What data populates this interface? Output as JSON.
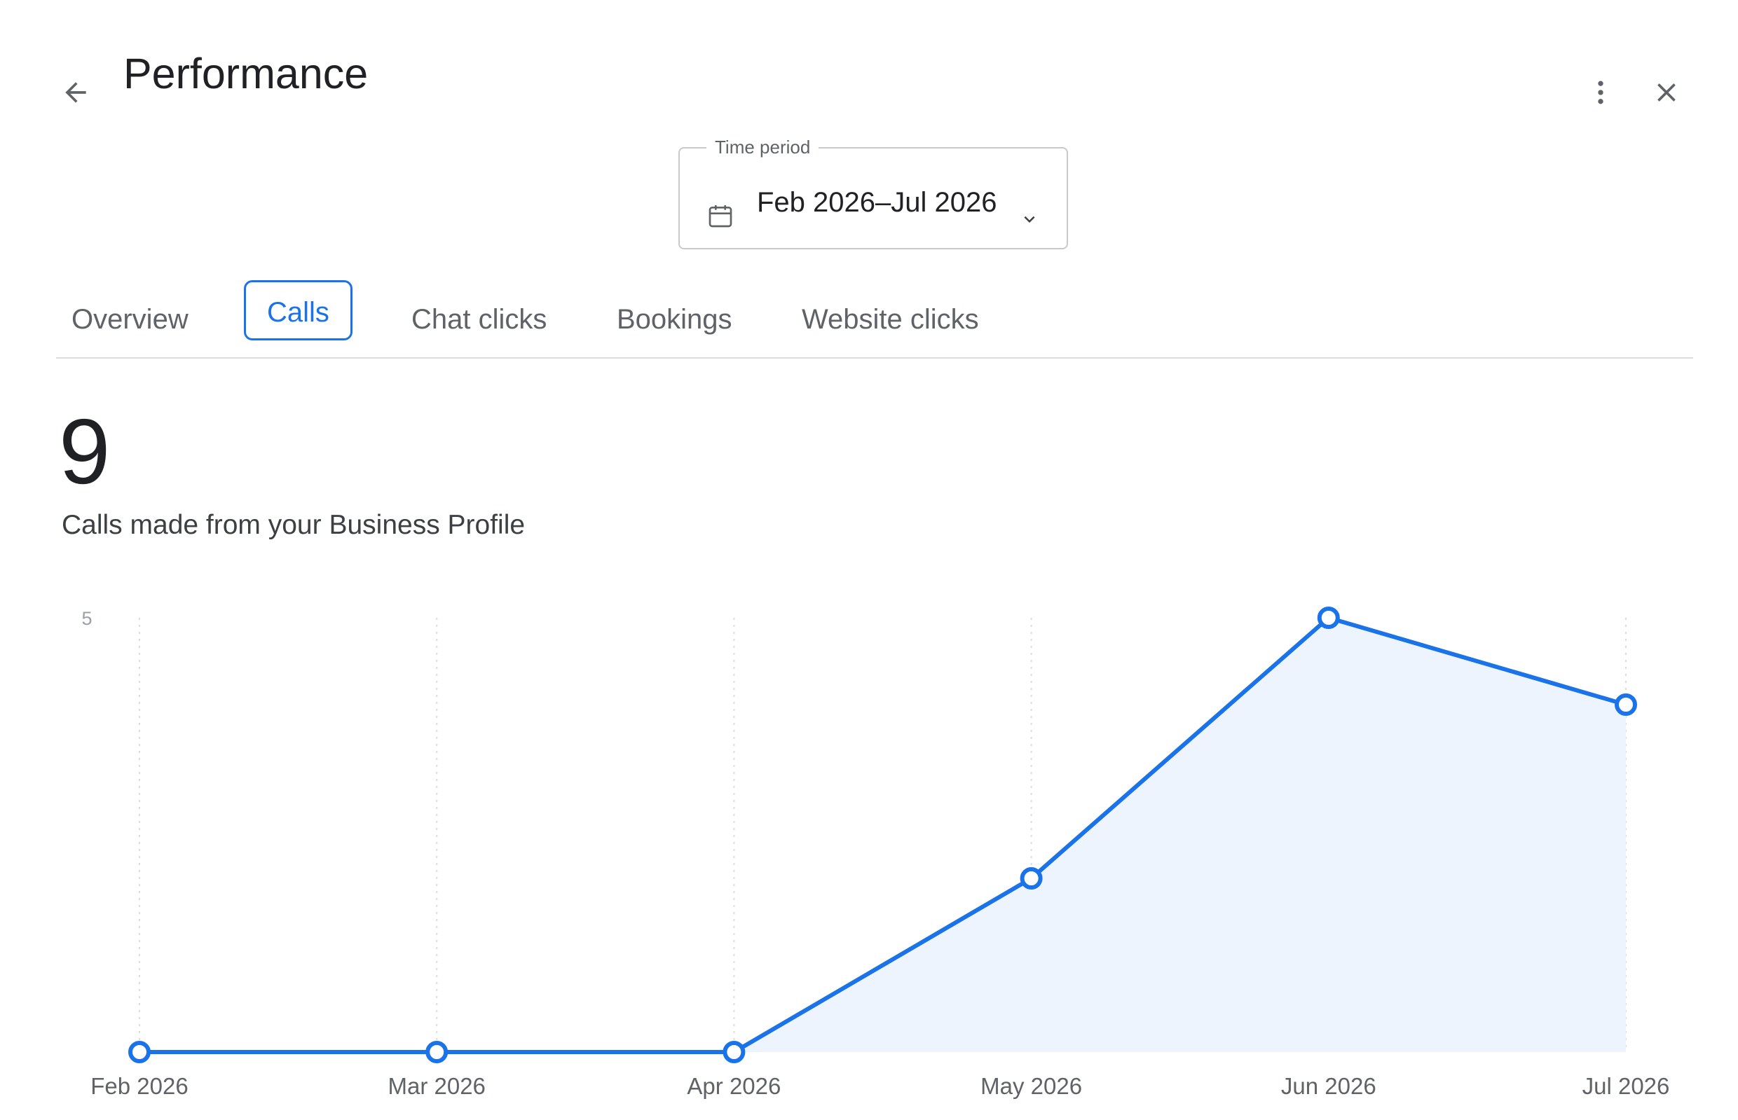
{
  "header": {
    "title": "Performance",
    "back_icon": "arrow-back-icon",
    "more_icon": "more-vert-icon",
    "close_icon": "close-icon"
  },
  "time_period": {
    "label": "Time period",
    "value": "Feb 2026–Jul 2026",
    "icon": "calendar-icon",
    "dropdown_icon": "chevron-down-icon"
  },
  "tabs": [
    {
      "label": "Overview",
      "active": false
    },
    {
      "label": "Calls",
      "active": true
    },
    {
      "label": "Chat clicks",
      "active": false
    },
    {
      "label": "Bookings",
      "active": false
    },
    {
      "label": "Website clicks",
      "active": false
    }
  ],
  "summary": {
    "total": "9",
    "description": "Calls made from your Business Profile"
  },
  "colors": {
    "accent": "#1a73e8",
    "area_fill": "#eef4fd",
    "grid": "#dadce0"
  },
  "chart_data": {
    "type": "area",
    "categories": [
      "Feb 2026",
      "Mar 2026",
      "Apr 2026",
      "May 2026",
      "Jun 2026",
      "Jul 2026"
    ],
    "values": [
      0,
      0,
      0,
      2,
      5,
      4
    ],
    "ylim": [
      0,
      5
    ],
    "yticks": [
      "5"
    ],
    "grid": "vertical dotted",
    "markers": "hollow circles"
  }
}
